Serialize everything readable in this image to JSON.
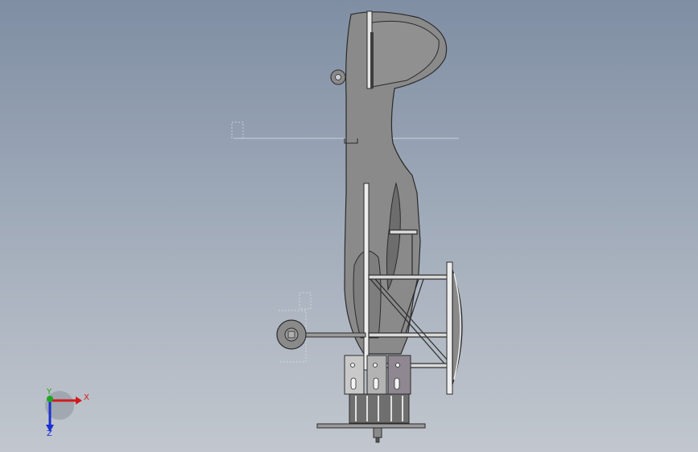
{
  "viewport": {
    "background_top": "#7f8ea3",
    "background_bottom": "#c2c7ce",
    "part_fill": "#8a8a8a",
    "part_stroke": "#2b2b2b"
  },
  "triad": {
    "x_label": "X",
    "y_label": "Y",
    "z_label": "Z",
    "x_color": "#d11a1a",
    "y_color": "#1fa51f",
    "z_color": "#1a2fd1"
  }
}
